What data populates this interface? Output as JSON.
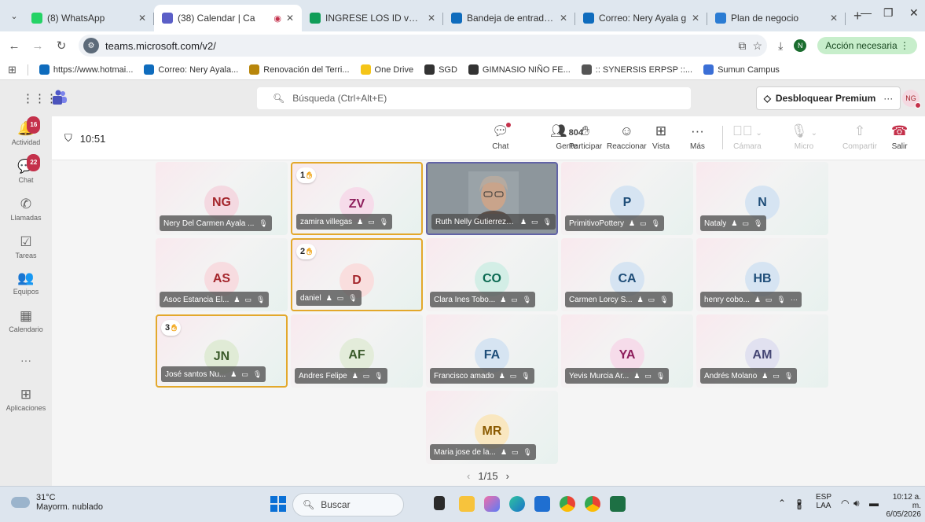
{
  "browser": {
    "tabs": [
      {
        "label": "(8) WhatsApp",
        "icon": "whatsapp-icon",
        "color": "#25d366",
        "active": false
      },
      {
        "label": "(38) Calendar | Ca",
        "icon": "teams-icon",
        "color": "#5b5fc7",
        "active": true
      },
      {
        "label": "INGRESE LOS ID verifi",
        "icon": "sheets-icon",
        "color": "#0f9d58",
        "active": false
      },
      {
        "label": "Bandeja de entrada: I",
        "icon": "outlook-icon",
        "color": "#0f6cbd",
        "active": false
      },
      {
        "label": "Correo: Nery Ayala g",
        "icon": "outlook-icon",
        "color": "#0f6cbd",
        "active": false
      },
      {
        "label": "Plan de negocio",
        "icon": "doc-icon",
        "color": "#2b7cd3",
        "active": false
      }
    ],
    "new_tab": "+",
    "url": "teams.microsoft.com/v2/",
    "profile_initial": "N",
    "action_label": "Acción necesaria",
    "bookmarks": [
      {
        "label": "https://www.hotmai...",
        "color": "#0f6cbd"
      },
      {
        "label": "Correo: Nery Ayala...",
        "color": "#0f6cbd"
      },
      {
        "label": "Renovación del Terri...",
        "color": "#b8860b"
      },
      {
        "label": "One Drive",
        "color": "#f5c518"
      },
      {
        "label": "SGD",
        "color": "#333333"
      },
      {
        "label": "GIMNASIO NIÑO FE...",
        "color": "#333333"
      },
      {
        "label": ":: SYNERSIS ERPSP ::...",
        "color": "#555555"
      },
      {
        "label": "Sumun Campus",
        "color": "#3b6fd6"
      }
    ]
  },
  "teams": {
    "search_placeholder": "Búsqueda (Ctrl+Alt+E)",
    "premium_label": "Desbloquear Premium",
    "more": "···",
    "user_initials": "NG"
  },
  "rail": [
    {
      "label": "Actividad",
      "icon": "bell-icon",
      "glyph": "🔔",
      "badge": "16"
    },
    {
      "label": "Chat",
      "icon": "chat-icon",
      "glyph": "💬",
      "badge": "22"
    },
    {
      "label": "Llamadas",
      "icon": "phone-icon",
      "glyph": "✆",
      "badge": ""
    },
    {
      "label": "Tareas",
      "icon": "tasks-icon",
      "glyph": "☑",
      "badge": ""
    },
    {
      "label": "Equipos",
      "icon": "teams-group-icon",
      "glyph": "👥",
      "badge": ""
    },
    {
      "label": "Calendario",
      "icon": "calendar-icon",
      "glyph": "▦",
      "badge": ""
    },
    {
      "label": "···",
      "icon": "more-icon",
      "glyph": "",
      "badge": ""
    },
    {
      "label": "Aplicaciones",
      "icon": "apps-icon",
      "glyph": "⊞",
      "badge": ""
    }
  ],
  "meeting": {
    "time": "10:51",
    "people_count": "804",
    "toolbar": [
      {
        "label": "Chat",
        "icon": "chat-icon"
      },
      {
        "label": "Gente",
        "icon": "people-icon"
      },
      {
        "label": "Participar",
        "icon": "raise-hand-icon"
      },
      {
        "label": "Reaccionar",
        "icon": "smiley-icon"
      },
      {
        "label": "Vista",
        "icon": "view-grid-icon"
      },
      {
        "label": "Más",
        "icon": "more-icon"
      },
      {
        "label": "Cámara",
        "icon": "camera-off-icon"
      },
      {
        "label": "Micro",
        "icon": "mic-off-icon"
      },
      {
        "label": "Compartir",
        "icon": "share-icon"
      },
      {
        "label": "Salir",
        "icon": "hangup-icon"
      }
    ],
    "participants": [
      {
        "initials": "NG",
        "name": "Nery Del Carmen Ayala ...",
        "hand": "",
        "color": "#a4262c",
        "bg": "#f4d9e1"
      },
      {
        "initials": "ZV",
        "name": "zamira villegas",
        "hand": "1",
        "color": "#8e1e5c",
        "bg": "#f6dcea"
      },
      {
        "initials": "",
        "name": "Ruth Nelly Gutierrez Achuri",
        "hand": "",
        "color": "",
        "bg": ""
      },
      {
        "initials": "P",
        "name": "PrimitivoPottery",
        "hand": "",
        "color": "#1f4e79",
        "bg": "#d6e4f2"
      },
      {
        "initials": "N",
        "name": "Nataly",
        "hand": "",
        "color": "#1f4e79",
        "bg": "#d6e4f2"
      },
      {
        "initials": "AS",
        "name": "Asoc Estancia El...",
        "hand": "",
        "color": "#a4262c",
        "bg": "#f7dce0"
      },
      {
        "initials": "D",
        "name": "daniel",
        "hand": "2",
        "color": "#a4262c",
        "bg": "#f9dede"
      },
      {
        "initials": "CO",
        "name": "Clara Ines Tobo...",
        "hand": "",
        "color": "#0b6a52",
        "bg": "#d3eee6"
      },
      {
        "initials": "CA",
        "name": "Carmen Lorcy S...",
        "hand": "",
        "color": "#1f4e79",
        "bg": "#d6e4f2"
      },
      {
        "initials": "HB",
        "name": "henry cobo...",
        "hand": "",
        "color": "#1f4e79",
        "bg": "#d6e4f2"
      },
      {
        "initials": "JN",
        "name": "José santos Nu...",
        "hand": "3",
        "color": "#3a5a2a",
        "bg": "#e0ebd6"
      },
      {
        "initials": "AF",
        "name": "Andres Felipe",
        "hand": "",
        "color": "#3a5a2a",
        "bg": "#e3ecda"
      },
      {
        "initials": "FA",
        "name": "Francisco amado",
        "hand": "",
        "color": "#1f4e79",
        "bg": "#d6e4f2"
      },
      {
        "initials": "YA",
        "name": "Yevis Murcia Ar...",
        "hand": "",
        "color": "#8e1e5c",
        "bg": "#f6dcea"
      },
      {
        "initials": "AM",
        "name": "Andrés Molano",
        "hand": "",
        "color": "#464775",
        "bg": "#e1e1f0"
      },
      {
        "initials": "MR",
        "name": "Maria jose de la...",
        "hand": "",
        "color": "#8a5a00",
        "bg": "#f9e7c0"
      }
    ],
    "pager": "1/15"
  },
  "taskbar": {
    "temperature": "31°C",
    "weather": "Mayorm. nublado",
    "search": "Buscar",
    "language": "ESP",
    "layout": "LAA",
    "time": "10:12 a. m.",
    "date": "6/05/2026"
  }
}
